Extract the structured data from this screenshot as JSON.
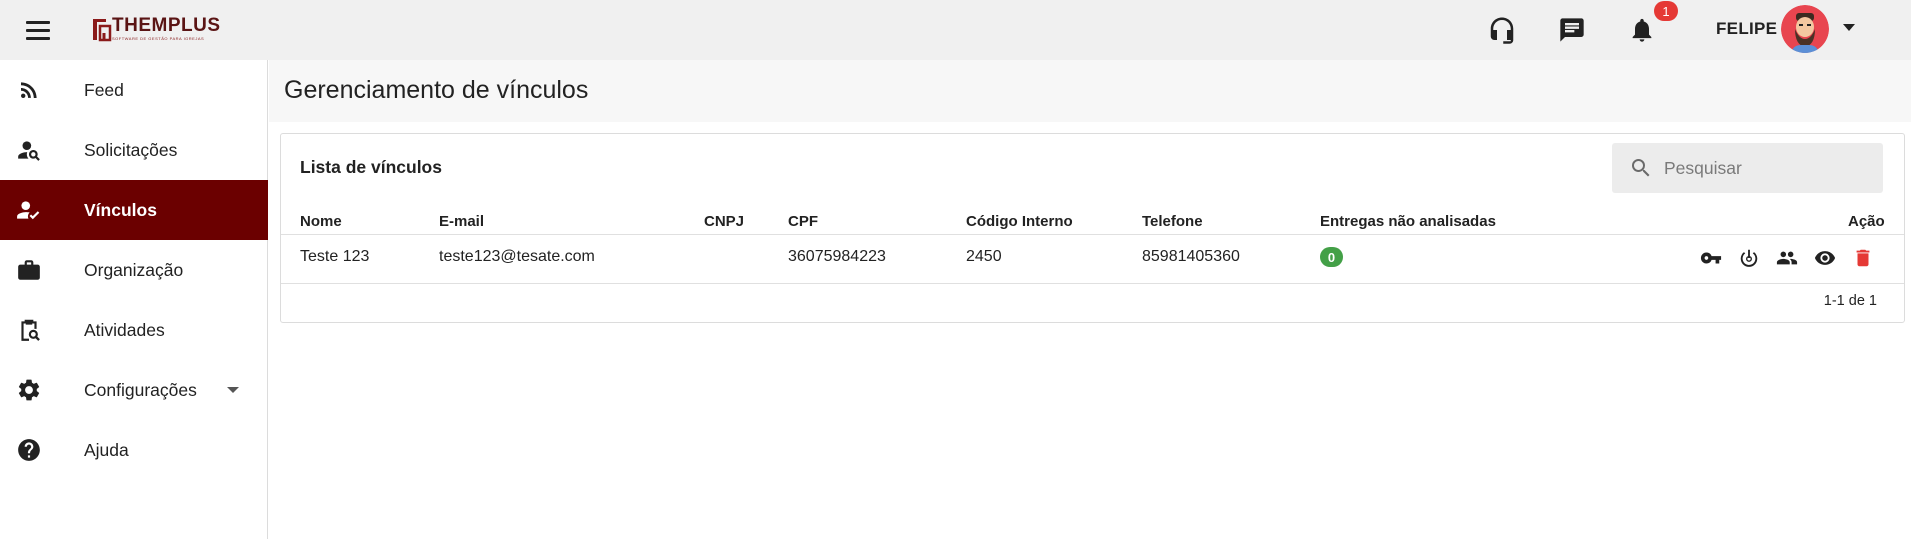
{
  "header": {
    "logo_text": "THEMPLUS",
    "logo_subtitle": "SOFTWARE DE GESTÃO PARA IGREJAS",
    "notification_count": "1",
    "username": "FELIPE",
    "icons": [
      "menu-icon",
      "headset-icon",
      "chat-icon",
      "bell-icon",
      "avatar",
      "chevron-down-icon"
    ]
  },
  "sidebar": {
    "items": [
      {
        "label": "Feed",
        "icon": "rss-icon"
      },
      {
        "label": "Solicitações",
        "icon": "person-search-icon"
      },
      {
        "label": "Vínculos",
        "icon": "person-check-icon",
        "active": true
      },
      {
        "label": "Organização",
        "icon": "briefcase-icon"
      },
      {
        "label": "Atividades",
        "icon": "clipboard-search-icon"
      },
      {
        "label": "Configurações",
        "icon": "gear-icon",
        "expandable": true
      },
      {
        "label": "Ajuda",
        "icon": "help-circle-icon"
      }
    ],
    "active_color": "#6b0000"
  },
  "main": {
    "page_title": "Gerenciamento de vínculos",
    "card": {
      "title": "Lista de vínculos",
      "search_placeholder": "Pesquisar",
      "columns": [
        "Nome",
        "E-mail",
        "CNPJ",
        "CPF",
        "Código Interno",
        "Telefone",
        "Entregas não analisadas",
        "Ação"
      ],
      "rows": [
        {
          "nome": "Teste 123",
          "email": "teste123@tesate.com",
          "cnpj": "",
          "cpf": "36075984223",
          "codigo_interno": "2450",
          "telefone": "85981405360",
          "entregas_nao_analisadas": "0",
          "actions": [
            "key-icon",
            "power-icon",
            "people-icon",
            "eye-icon",
            "trash-icon"
          ]
        }
      ],
      "pagination": "1-1 de 1"
    }
  },
  "colors": {
    "brand": "#6b0000",
    "badge": "#e53935",
    "status_green": "#43a047",
    "delete_red": "#e53935"
  }
}
